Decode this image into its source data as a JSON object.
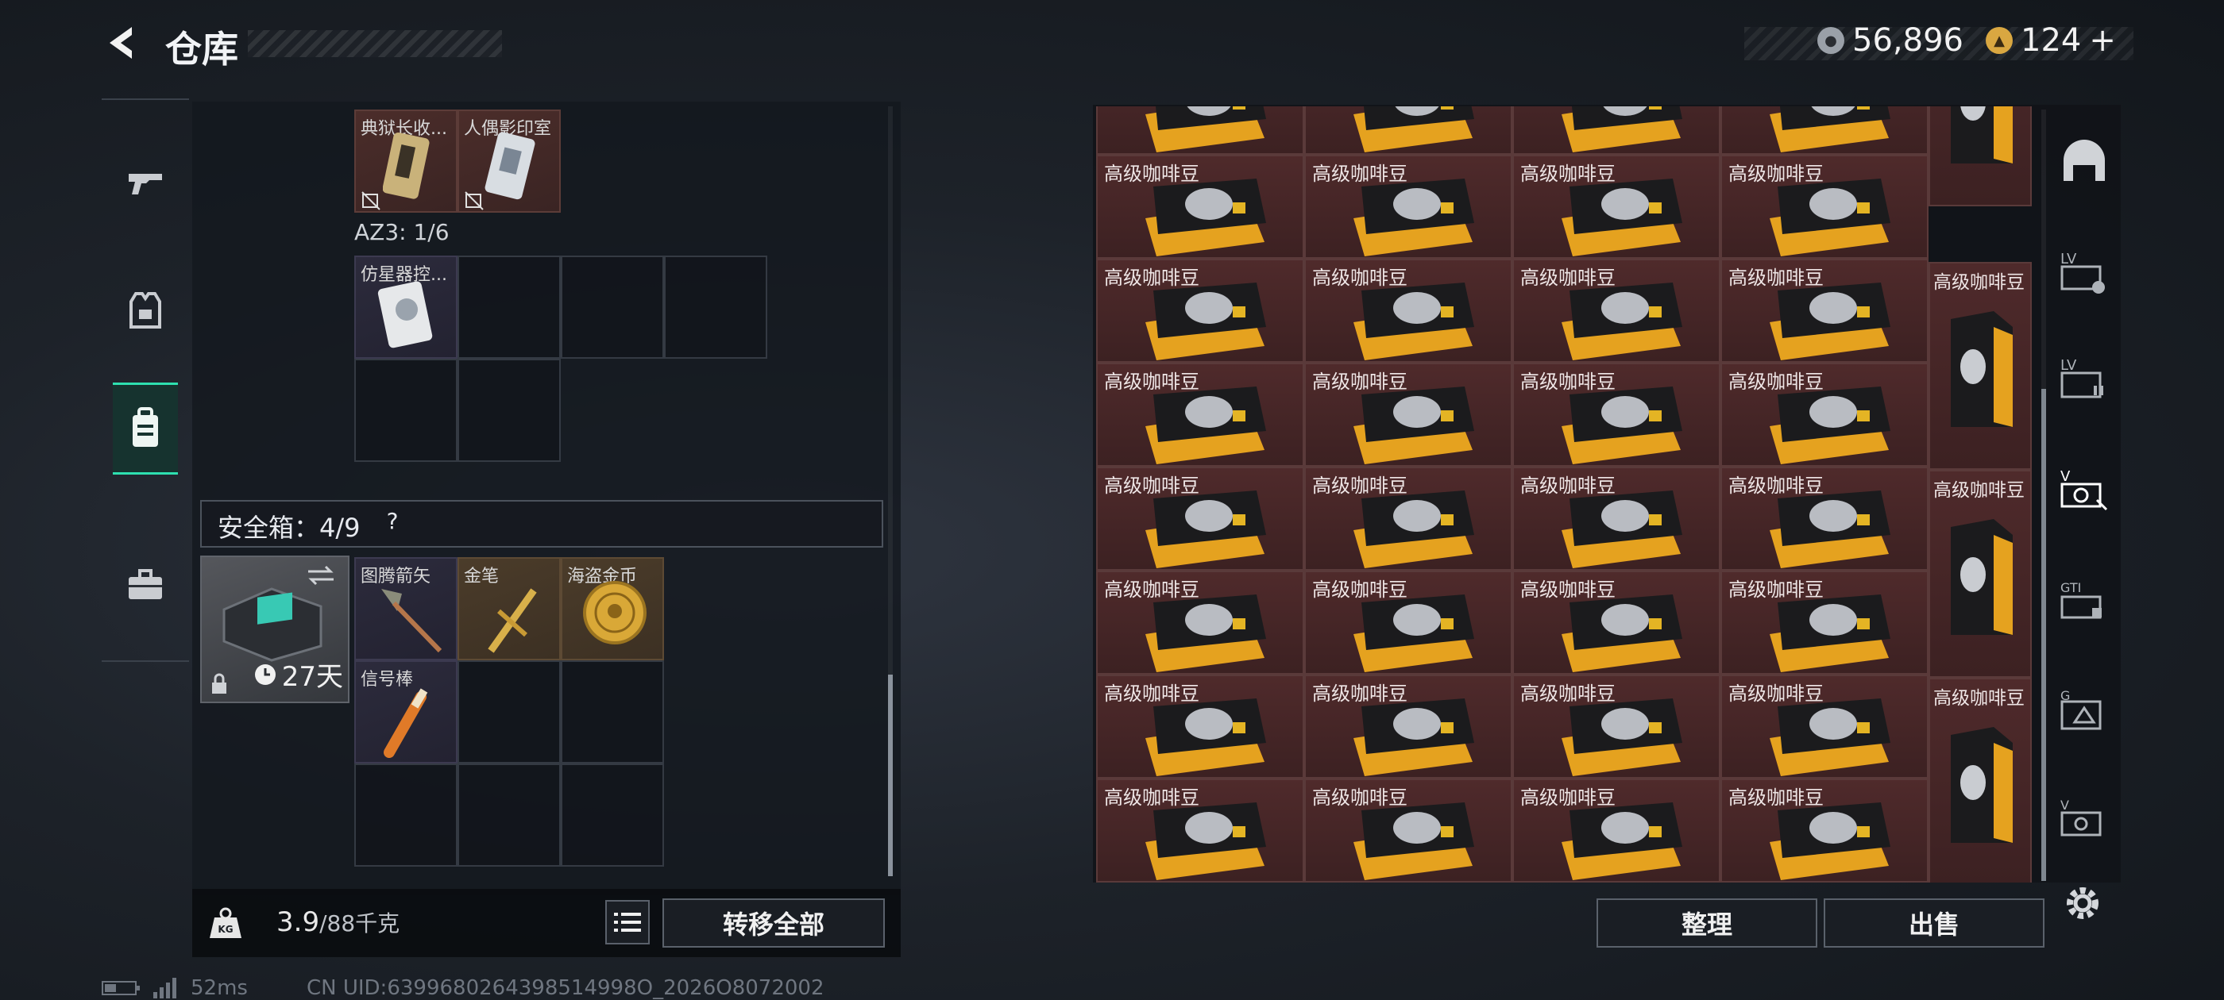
{
  "header": {
    "title": "仓库",
    "currency": [
      {
        "icon": "silver-coin-icon",
        "value": "56,896"
      },
      {
        "icon": "gold-triangle-icon",
        "value": "124",
        "suffix": "+"
      }
    ]
  },
  "left_rail": [
    {
      "icon": "gun-icon",
      "active": false
    },
    {
      "icon": "armor-vest-icon",
      "active": false
    },
    {
      "icon": "backpack-icon",
      "active": true
    },
    {
      "icon": "briefcase-icon",
      "active": false
    }
  ],
  "backpack": {
    "top_items": [
      "典狱长收...",
      "人偶影印室"
    ],
    "az3_label": "AZ3: 1/6",
    "az3_items": [
      "仿星器控..."
    ]
  },
  "safe_box": {
    "label": "安全箱：4/9",
    "help": "?",
    "days": "27天",
    "items": [
      "图腾箭矢",
      "金笔",
      "海盗金币",
      "信号棒"
    ]
  },
  "weight": {
    "current": "3.9",
    "max": "/88千克",
    "transfer_all": "转移全部"
  },
  "stash": {
    "item_name": "高级咖啡豆",
    "rows": 7,
    "sort_label": "整理",
    "sell_label": "出售"
  },
  "right_rail": [
    {
      "icon": "shelter-icon"
    },
    {
      "icon": "stash-lv-icon"
    },
    {
      "icon": "stash-lv2-icon"
    },
    {
      "icon": "stash-v-icon"
    },
    {
      "icon": "stash-gti-icon"
    },
    {
      "icon": "stash-g-icon"
    },
    {
      "icon": "stash-v2-icon"
    },
    {
      "icon": "settings-gear-icon"
    }
  ],
  "footer": {
    "ping": "52ms",
    "uid": "CN UID:6399680264398514998O_2026O8072002"
  }
}
